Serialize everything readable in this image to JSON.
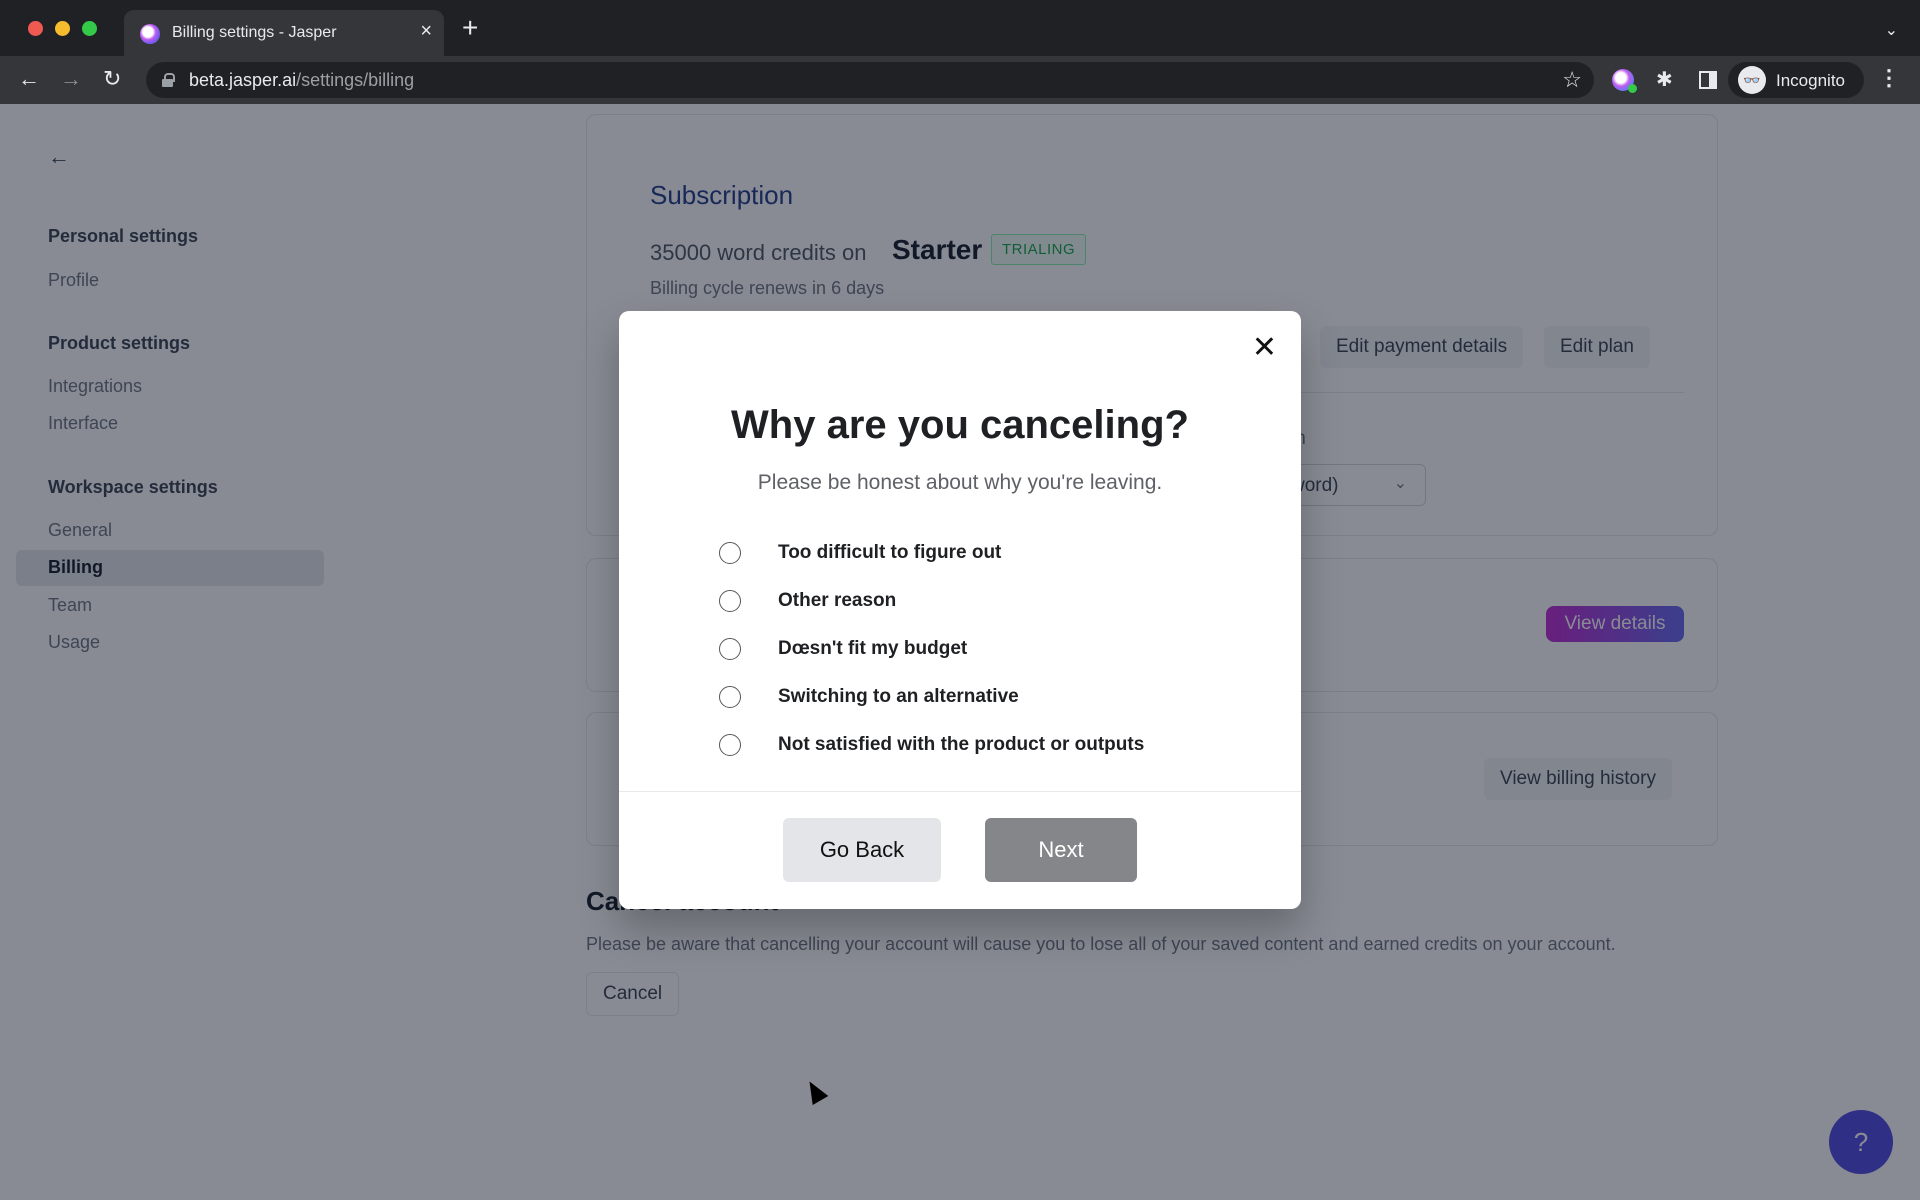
{
  "browser": {
    "tab_title": "Billing settings - Jasper",
    "tab_close": "×",
    "new_tab": "+",
    "tabs_menu": "⌄",
    "url_host": "beta.jasper.ai",
    "url_path": "/settings/billing",
    "back": "←",
    "forward": "→",
    "reload": "↻",
    "bookmark": "☆",
    "extension_puzzle": "✱",
    "profile_label": "Incognito",
    "incognito_glyph": "👓",
    "menu": "⋮"
  },
  "sidebar": {
    "back": "←",
    "sections": [
      {
        "heading": "Personal settings",
        "items": [
          "Profile"
        ]
      },
      {
        "heading": "Product settings",
        "items": [
          "Integrations",
          "Interface"
        ]
      },
      {
        "heading": "Workspace settings",
        "items": [
          "General",
          "Billing",
          "Team",
          "Usage"
        ]
      }
    ],
    "active_item": "Billing"
  },
  "subscription": {
    "title": "Subscription",
    "credits": "35000 word credits  on",
    "plan": "Starter",
    "status_badge": "TRIALING",
    "renews": "Billing cycle renews in 6 days",
    "edit_payment": "Edit payment details",
    "edit_plan": "Edit plan",
    "partial_label": "th",
    "select_value": "word)",
    "select_chevron": "⌄"
  },
  "details": {
    "view_details": "View details"
  },
  "history": {
    "view_billing_history": "View billing history"
  },
  "cancel_account": {
    "title": "Cancel account",
    "text": "Please be aware that cancelling your account will cause you to lose all of your saved content and earned credits on your account.",
    "button": "Cancel"
  },
  "help": {
    "label": "?"
  },
  "modal": {
    "close": "✕",
    "title": "Why are you canceling?",
    "subtitle": "Please be honest about why you're leaving.",
    "options": [
      {
        "label": "Too difficult to figure out",
        "selected": false
      },
      {
        "label": "Other reason",
        "selected": false
      },
      {
        "label": "Dœsn't fit my budget",
        "selected": false
      },
      {
        "label": "Switching to an alternative",
        "selected": false
      },
      {
        "label": "Not satisfied with the product or outputs",
        "selected": false
      }
    ],
    "go_back": "Go Back",
    "next": "Next"
  }
}
